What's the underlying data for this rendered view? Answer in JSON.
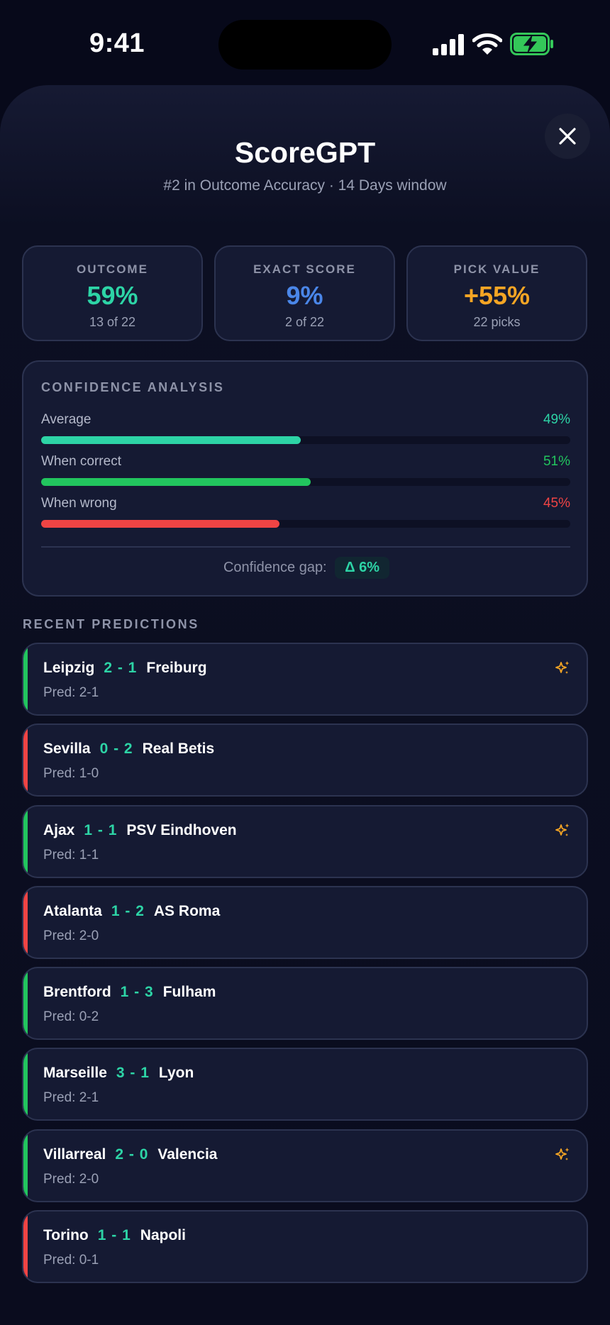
{
  "status": {
    "time": "9:41"
  },
  "header": {
    "title": "ScoreGPT",
    "subtitle": "#2 in Outcome Accuracy · 14 Days window",
    "close_icon": "close-icon"
  },
  "stats": [
    {
      "label": "OUTCOME",
      "value": "59%",
      "sub": "13 of 22",
      "color": "#2dd4a6"
    },
    {
      "label": "EXACT SCORE",
      "value": "9%",
      "sub": "2 of 22",
      "color": "#4a86e8"
    },
    {
      "label": "PICK VALUE",
      "value": "+55%",
      "sub": "22 picks",
      "color": "#f5a524"
    }
  ],
  "confidence": {
    "title": "CONFIDENCE ANALYSIS",
    "rows": [
      {
        "label": "Average",
        "value": "49%",
        "fraction": 0.49,
        "color": "#2dd4a6"
      },
      {
        "label": "When correct",
        "value": "51%",
        "fraction": 0.51,
        "color": "#22c55e"
      },
      {
        "label": "When wrong",
        "value": "45%",
        "fraction": 0.45,
        "color": "#ef4444"
      }
    ],
    "gap_label": "Confidence gap:",
    "gap_value": "Δ 6%"
  },
  "recent": {
    "title": "RECENT PREDICTIONS",
    "items": [
      {
        "home": "Leipzig",
        "score": "2 - 1",
        "away": "Freiburg",
        "pred": "Pred: 2-1",
        "result_color": "#22c55e",
        "exact": true
      },
      {
        "home": "Sevilla",
        "score": "0 - 2",
        "away": "Real Betis",
        "pred": "Pred: 1-0",
        "result_color": "#ef4444",
        "exact": false
      },
      {
        "home": "Ajax",
        "score": "1 - 1",
        "away": "PSV Eindhoven",
        "pred": "Pred: 1-1",
        "result_color": "#22c55e",
        "exact": true
      },
      {
        "home": "Atalanta",
        "score": "1 - 2",
        "away": "AS Roma",
        "pred": "Pred: 2-0",
        "result_color": "#ef4444",
        "exact": false
      },
      {
        "home": "Brentford",
        "score": "1 - 3",
        "away": "Fulham",
        "pred": "Pred: 0-2",
        "result_color": "#22c55e",
        "exact": false
      },
      {
        "home": "Marseille",
        "score": "3 - 1",
        "away": "Lyon",
        "pred": "Pred: 2-1",
        "result_color": "#22c55e",
        "exact": false
      },
      {
        "home": "Villarreal",
        "score": "2 - 0",
        "away": "Valencia",
        "pred": "Pred: 2-0",
        "result_color": "#22c55e",
        "exact": true
      },
      {
        "home": "Torino",
        "score": "1 - 1",
        "away": "Napoli",
        "pred": "Pred: 0-1",
        "result_color": "#ef4444",
        "exact": false
      }
    ]
  }
}
